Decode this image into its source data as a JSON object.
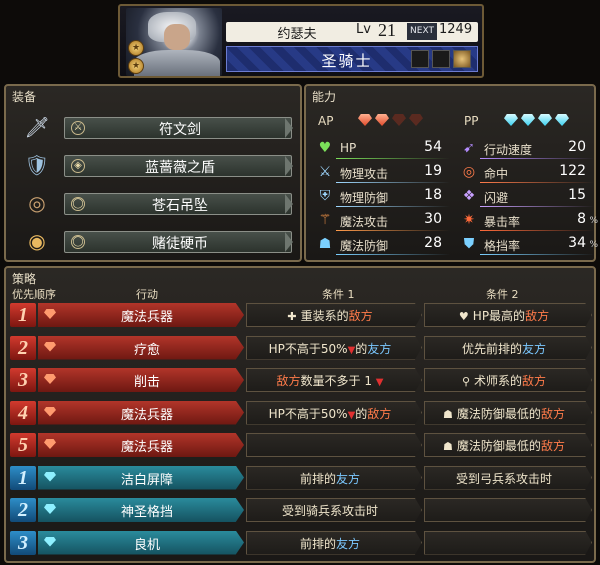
{
  "header": {
    "name": "约瑟夫",
    "lv_label": "Lv",
    "level": "21",
    "next_label": "NEXT",
    "next_exp": "1249",
    "class_name": "圣骑士"
  },
  "equipment": {
    "title": "装备",
    "items": [
      {
        "label": "符文剑",
        "icon": "sword-icon"
      },
      {
        "label": "蓝蔷薇之盾",
        "icon": "shield-icon"
      },
      {
        "label": "苍石吊坠",
        "icon": "pendant-icon"
      },
      {
        "label": "赌徒硬币",
        "icon": "coin-icon"
      }
    ]
  },
  "abilities": {
    "title": "能力",
    "ap_label": "AP",
    "pp_label": "PP",
    "ap_gems": 4,
    "ap_filled": 2,
    "pp_gems": 4,
    "pp_filled": 4,
    "left": [
      {
        "name": "HP",
        "value": "54",
        "icon": "heart-icon",
        "color": "#7be05a"
      },
      {
        "name": "物理攻击",
        "value": "19",
        "icon": "sword-stat-icon",
        "color": "#9fd8ff"
      },
      {
        "name": "物理防御",
        "value": "18",
        "icon": "armor-icon",
        "color": "#9fd8ff"
      },
      {
        "name": "魔法攻击",
        "value": "30",
        "icon": "staff-icon",
        "color": "#ff9a4a"
      },
      {
        "name": "魔法防御",
        "value": "28",
        "icon": "magic-defense-icon",
        "color": "#7bd0ff"
      }
    ],
    "right": [
      {
        "name": "行动速度",
        "value": "20",
        "icon": "speed-icon",
        "color": "#b48cff",
        "pct": ""
      },
      {
        "name": "命中",
        "value": "122",
        "icon": "target-icon",
        "color": "#ff7b4a",
        "pct": ""
      },
      {
        "name": "闪避",
        "value": "15",
        "icon": "evade-icon",
        "color": "#c8a0ff",
        "pct": ""
      },
      {
        "name": "暴击率",
        "value": "8",
        "icon": "crit-icon",
        "color": "#ff6a3a",
        "pct": "%"
      },
      {
        "name": "格挡率",
        "value": "34",
        "icon": "block-icon",
        "color": "#7bd0ff",
        "pct": "%"
      }
    ]
  },
  "strategy": {
    "title": "策略",
    "headers": {
      "priority": "优先顺序",
      "action": "行动",
      "cond1": "条件 1",
      "cond2": "条件 2"
    },
    "rows": [
      {
        "num": "1",
        "type": "red",
        "action": "魔法兵器",
        "c1": [
          {
            "t": "✚ ",
            "cls": "ico"
          },
          {
            "t": "重装系的",
            "cls": ""
          },
          {
            "t": "敌方",
            "cls": "hl"
          }
        ],
        "c2": [
          {
            "t": "♥ ",
            "cls": "ico"
          },
          {
            "t": "HP最高的",
            "cls": ""
          },
          {
            "t": "敌方",
            "cls": "hl"
          }
        ]
      },
      {
        "num": "2",
        "type": "red",
        "action": "疗愈",
        "c1": [
          {
            "t": "HP不高于50%",
            "cls": ""
          },
          {
            "t": "▼",
            "cls": "tri"
          },
          {
            "t": "的",
            "cls": ""
          },
          {
            "t": "友方",
            "cls": "hlb"
          }
        ],
        "c2": [
          {
            "t": "优先前排的",
            "cls": ""
          },
          {
            "t": "友方",
            "cls": "hlb"
          }
        ]
      },
      {
        "num": "3",
        "type": "red",
        "action": "削击",
        "c1": [
          {
            "t": "敌方",
            "cls": "hl"
          },
          {
            "t": "数量不多于 1 ",
            "cls": ""
          },
          {
            "t": "▼",
            "cls": "tri"
          }
        ],
        "c2": [
          {
            "t": "⚲ ",
            "cls": "ico"
          },
          {
            "t": "术师系的",
            "cls": ""
          },
          {
            "t": "敌方",
            "cls": "hl"
          }
        ]
      },
      {
        "num": "4",
        "type": "red",
        "action": "魔法兵器",
        "c1": [
          {
            "t": "HP不高于50%",
            "cls": ""
          },
          {
            "t": "▼",
            "cls": "tri"
          },
          {
            "t": "的",
            "cls": ""
          },
          {
            "t": "敌方",
            "cls": "hl"
          }
        ],
        "c2": [
          {
            "t": "☗ ",
            "cls": "ico"
          },
          {
            "t": "魔法防御最低的",
            "cls": ""
          },
          {
            "t": "敌方",
            "cls": "hl"
          }
        ]
      },
      {
        "num": "5",
        "type": "red",
        "action": "魔法兵器",
        "c1": [],
        "c2": [
          {
            "t": "☗ ",
            "cls": "ico"
          },
          {
            "t": "魔法防御最低的",
            "cls": ""
          },
          {
            "t": "敌方",
            "cls": "hl"
          }
        ]
      },
      {
        "num": "1",
        "type": "blue",
        "action": "洁白屏障",
        "c1": [
          {
            "t": "前排的",
            "cls": ""
          },
          {
            "t": "友方",
            "cls": "hlb"
          }
        ],
        "c2": [
          {
            "t": "受到弓兵系攻击时",
            "cls": ""
          }
        ]
      },
      {
        "num": "2",
        "type": "blue",
        "action": "神圣格挡",
        "c1": [
          {
            "t": "受到骑兵系攻击时",
            "cls": ""
          }
        ],
        "c2": []
      },
      {
        "num": "3",
        "type": "blue",
        "action": "良机",
        "c1": [
          {
            "t": "前排的",
            "cls": ""
          },
          {
            "t": "友方",
            "cls": "hlb"
          }
        ],
        "c2": []
      }
    ]
  }
}
